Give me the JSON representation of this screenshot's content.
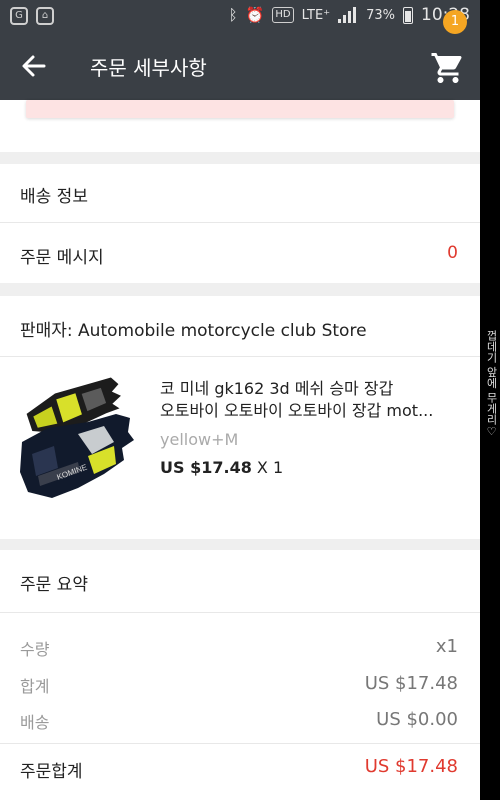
{
  "status_bar": {
    "battery": "73%",
    "network": "LTE⁺",
    "hd": "HD",
    "time": "10:28"
  },
  "toolbar": {
    "title": "주문 세부사항",
    "cart_badge": "1"
  },
  "info_rows": {
    "shipping_label": "배송 정보",
    "message_label": "주문 메시지",
    "message_count": "0"
  },
  "seller": {
    "label": "판매자: Automobile motorcycle club Store"
  },
  "product": {
    "title_line1": "코 미네 gk162 3d 메쉬 승마 장갑",
    "title_line2": "오토바이 오토바이 오토바이 장갑 mot...",
    "variant": "yellow+M",
    "price": "US $17.48",
    "quantity": "X 1"
  },
  "summary": {
    "title": "주문 요약",
    "rows": [
      {
        "label": "수량",
        "value": "x1"
      },
      {
        "label": "합계",
        "value": "US $17.48"
      },
      {
        "label": "배송",
        "value": "US $0.00"
      }
    ],
    "total_label": "주문합계",
    "total_value": "US $17.48"
  },
  "side_text": "껍데기 앞에 무게리♡",
  "colors": {
    "toolbar": "#3a3f45",
    "accent_red": "#e03a2f",
    "badge": "#f5a623",
    "background": "#efefef"
  }
}
